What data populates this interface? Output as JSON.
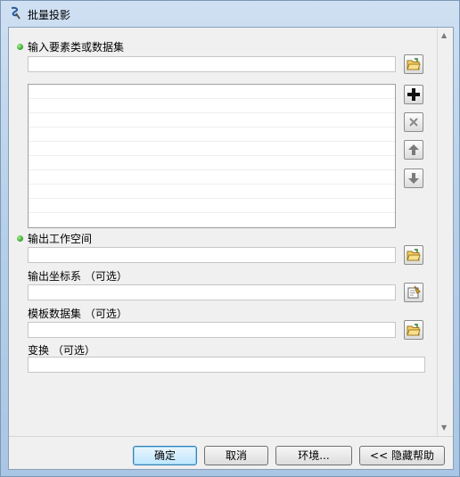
{
  "window": {
    "title": "批量投影",
    "icon": "tool-icon"
  },
  "form": {
    "input_label": "输入要素类或数据集",
    "output_workspace_label": "输出工作空间",
    "output_crs_label": "输出坐标系 （可选）",
    "template_dataset_label": "模板数据集 （可选）",
    "transform_label": "变换 （可选）",
    "input_value": "",
    "output_workspace_value": "",
    "output_crs_value": "",
    "template_dataset_value": "",
    "transform_value": ""
  },
  "list_buttons": {
    "add": "plus-icon",
    "remove": "x-icon",
    "up": "arrow-up-icon",
    "down": "arrow-down-icon"
  },
  "footer": {
    "ok": "确定",
    "cancel": "取消",
    "environments": "环境...",
    "hide_help": "<< 隐藏帮助"
  },
  "colors": {
    "required_dot": "#2fa02f",
    "default_button_border": "#3c7fb1"
  }
}
